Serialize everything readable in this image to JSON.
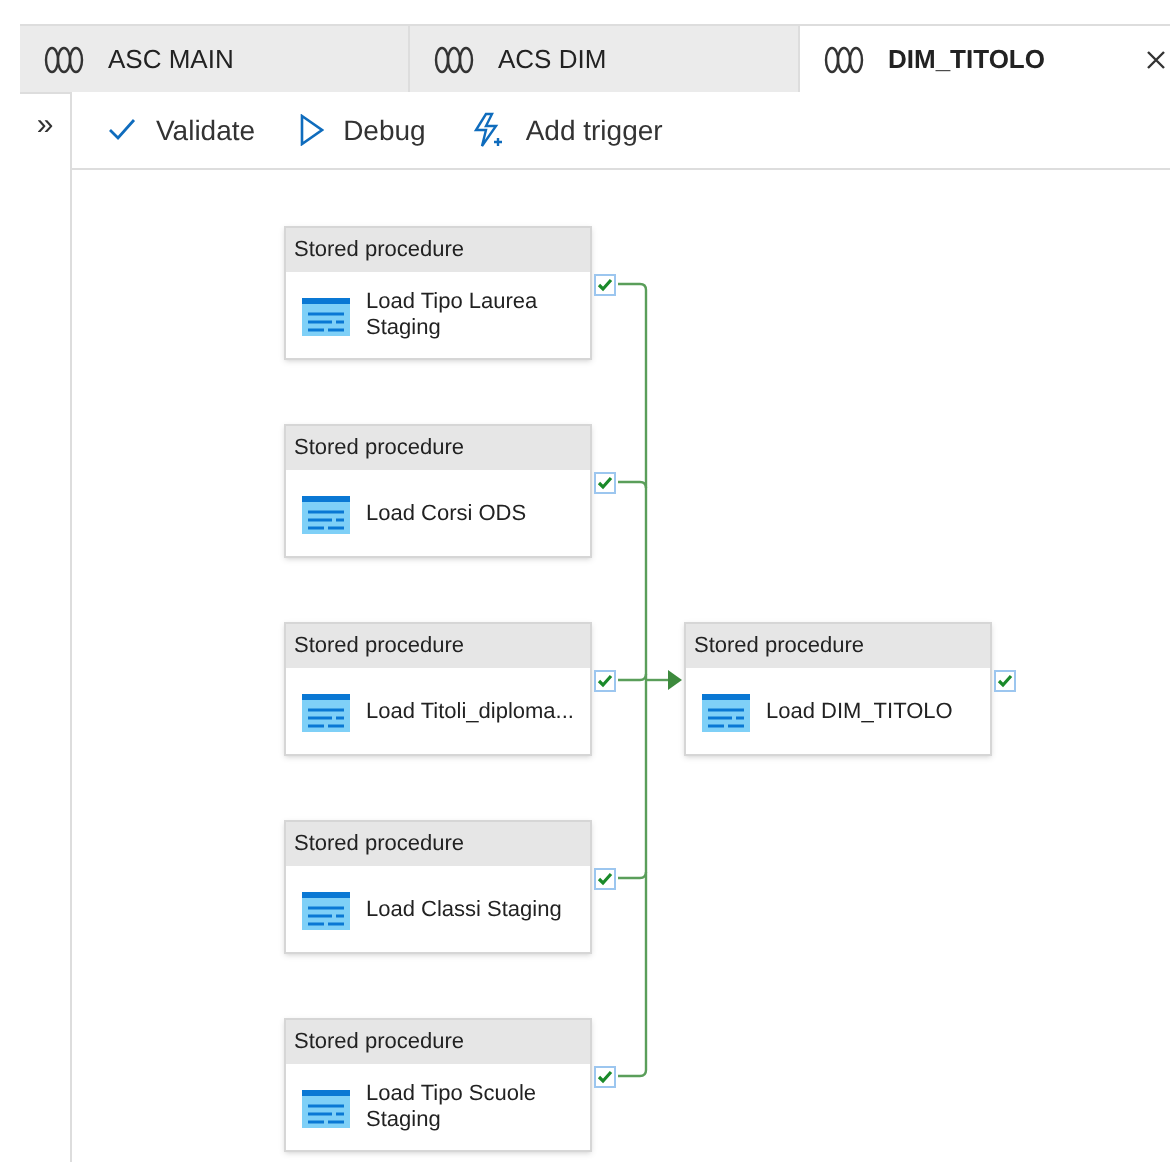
{
  "tabs": [
    {
      "label": "ASC MAIN",
      "selected": false
    },
    {
      "label": "ACS DIM",
      "selected": false
    },
    {
      "label": "DIM_TITOLO",
      "selected": true
    }
  ],
  "sidebar": {
    "toggle": "»"
  },
  "toolbar": [
    {
      "kind": "validate",
      "label": "Validate"
    },
    {
      "kind": "debug",
      "label": "Debug"
    },
    {
      "kind": "trigger",
      "label": "Add trigger"
    }
  ],
  "sources": [
    {
      "type": "Stored procedure",
      "name": "Load Tipo Laurea Staging"
    },
    {
      "type": "Stored procedure",
      "name": "Load Corsi ODS"
    },
    {
      "type": "Stored procedure",
      "name": "Load Titoli_diploma..."
    },
    {
      "type": "Stored procedure",
      "name": "Load Classi Staging"
    },
    {
      "type": "Stored procedure",
      "name": "Load Tipo Scuole Staging"
    }
  ],
  "target": {
    "type": "Stored procedure",
    "name": "Load DIM_TITOLO"
  }
}
